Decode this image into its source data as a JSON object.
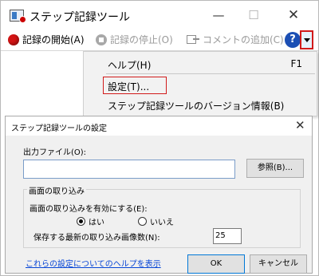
{
  "window": {
    "title": "ステップ記録ツール",
    "minimize": "—",
    "maximize": "☐",
    "close": "✕"
  },
  "toolbar": {
    "record_label": "記録の開始(A)",
    "stop_label": "記録の停止(O)",
    "comment_label": "コメントの追加(C)",
    "help_icon": "?"
  },
  "menu": {
    "help_label": "ヘルプ(H)",
    "help_shortcut": "F1",
    "settings_label": "設定(T)...",
    "about_label": "ステップ記録ツールのバージョン情報(B)"
  },
  "dialog": {
    "title": "ステップ記録ツールの設定",
    "close": "✕",
    "output_label": "出力ファイル(O):",
    "output_value": "",
    "browse_label": "参照(B)...",
    "capture_group": "画面の取り込み",
    "enable_label": "画面の取り込みを有効にする(E):",
    "radio_yes": "はい",
    "radio_no": "いいえ",
    "count_label": "保存する最新の取り込み画像数(N):",
    "count_value": "25",
    "help_link": "これらの設定についてのヘルプを表示",
    "ok_label": "OK",
    "cancel_label": "キャンセル"
  },
  "colors": {
    "record_red": "#d21414",
    "highlight_red": "#d11a1a",
    "help_blue": "#1c4fb4",
    "link_blue": "#0645d6"
  }
}
